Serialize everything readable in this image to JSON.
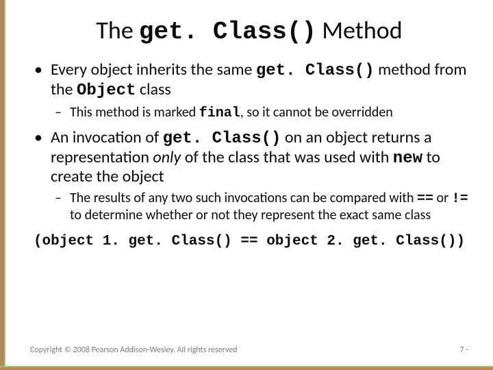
{
  "title": {
    "prefix": "The ",
    "method": "get. Class()",
    "suffix": " Method"
  },
  "bullets": [
    {
      "pre": "Every object inherits the same ",
      "code1": "get. Class()",
      "mid": " method from the ",
      "code2": "Object",
      "post": " class",
      "sub": [
        {
          "pre": "This method is marked ",
          "code1": "final",
          "post": ", so it cannot be overridden"
        }
      ]
    },
    {
      "pre": "An invocation of ",
      "code1": "get. Class()",
      "mid": " on an object returns a representation ",
      "italic": "only",
      "mid2": " of the class that was used with ",
      "code2": "new",
      "post": " to create the object",
      "sub": [
        {
          "pre": "The results of any two such invocations can be compared with ",
          "code1": "==",
          "mid": " or ",
          "code2": "!=",
          "post": " to determine whether or not they represent the exact same class"
        }
      ],
      "code_line": "(object 1. get. Class() == object 2. get. Class())"
    }
  ],
  "footer": {
    "copyright": "Copyright © 2008 Pearson Addison-Wesley. All rights reserved",
    "page": "7 -"
  }
}
